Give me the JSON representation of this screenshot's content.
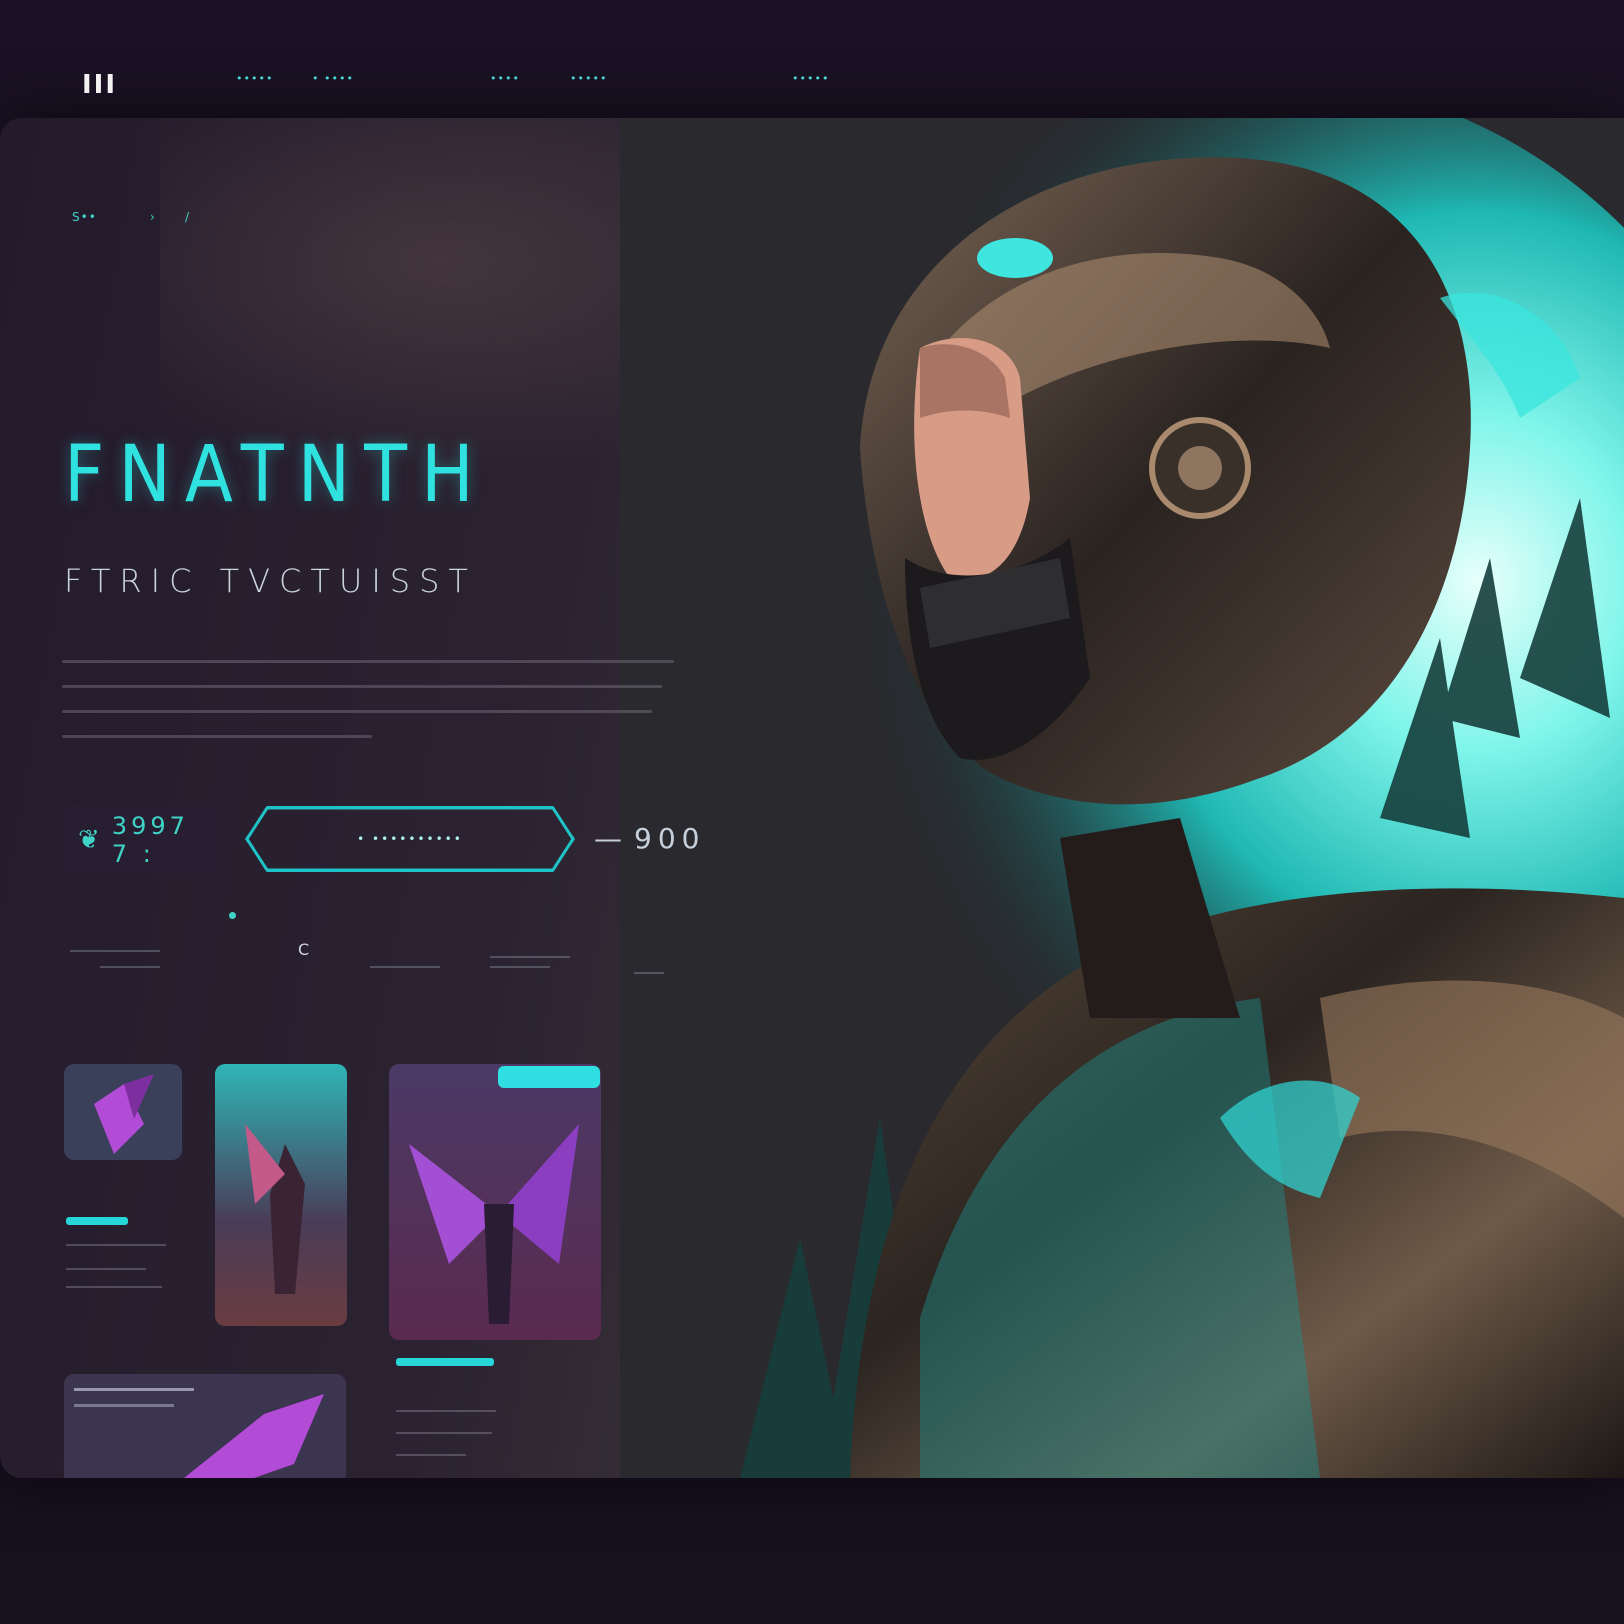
{
  "nav": {
    "logo": "III",
    "links": [
      "•••••",
      "• ••••",
      "••••",
      "•••••",
      "•••••"
    ]
  },
  "crumbs": [
    "S••",
    "›",
    "/"
  ],
  "hero": {
    "title": "FNATNTH",
    "subtitle": "FTRIC TVCTUISST"
  },
  "actions": {
    "chip_label": "3997 7 :",
    "cta_label": "• ••••••••••",
    "counter": "900"
  },
  "stats": {
    "dot_label": "",
    "ring_label": "C"
  },
  "colors": {
    "accent": "#2fe1df",
    "background": "#160f1f",
    "purple": "#b24bd6"
  },
  "icons": {
    "cta_arrow": "hexagon-button-shape",
    "chip": "leaf-icon"
  }
}
